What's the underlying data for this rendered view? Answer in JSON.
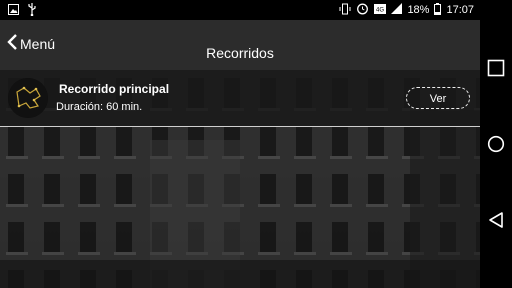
{
  "status_bar": {
    "battery_percent": "18%",
    "time": "17:07",
    "icons": [
      "image-icon",
      "usb-icon",
      "vibrate-icon",
      "alarm-icon",
      "network-icon",
      "signal-icon",
      "battery-icon"
    ]
  },
  "app_bar": {
    "back_label": "Menú",
    "title": "Recorridos"
  },
  "tour": {
    "name": "Recorrido principal",
    "duration": "Duración: 60 min.",
    "view_label": "Ver"
  },
  "nav_bar": {
    "icons": [
      "recent-apps-icon",
      "home-icon",
      "back-icon"
    ]
  }
}
